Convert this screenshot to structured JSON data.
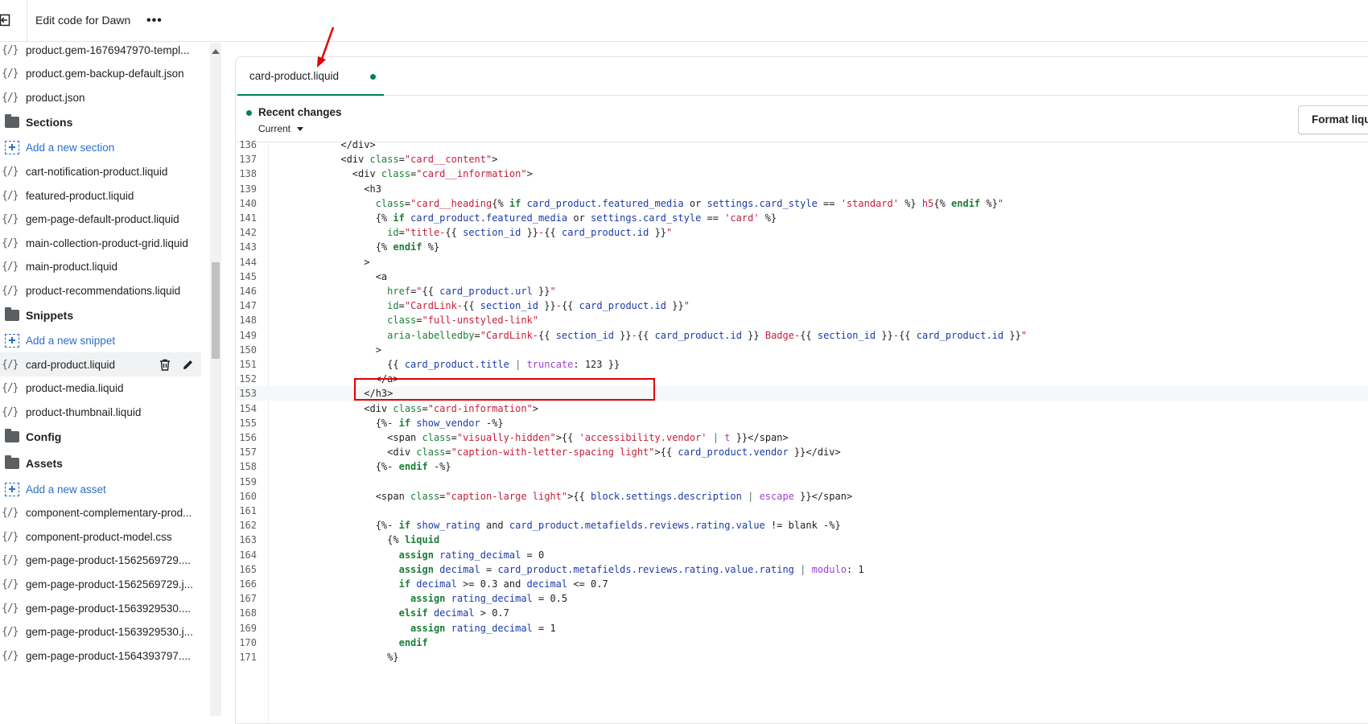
{
  "topbar": {
    "title": "Edit code for Dawn",
    "more_label": "•••"
  },
  "sidebar": {
    "items": [
      {
        "type": "file",
        "label": "product.gem-1676947970-templ..."
      },
      {
        "type": "file",
        "label": "product.gem-backup-default.json"
      },
      {
        "type": "file",
        "label": "product.json"
      },
      {
        "type": "folder",
        "label": "Sections"
      },
      {
        "type": "add",
        "label": "Add a new section"
      },
      {
        "type": "file",
        "label": "cart-notification-product.liquid"
      },
      {
        "type": "file",
        "label": "featured-product.liquid"
      },
      {
        "type": "file",
        "label": "gem-page-default-product.liquid"
      },
      {
        "type": "file",
        "label": "main-collection-product-grid.liquid"
      },
      {
        "type": "file",
        "label": "main-product.liquid"
      },
      {
        "type": "file",
        "label": "product-recommendations.liquid"
      },
      {
        "type": "folder",
        "label": "Snippets"
      },
      {
        "type": "add",
        "label": "Add a new snippet"
      },
      {
        "type": "file",
        "label": "card-product.liquid",
        "active": true
      },
      {
        "type": "file",
        "label": "product-media.liquid"
      },
      {
        "type": "file",
        "label": "product-thumbnail.liquid"
      },
      {
        "type": "folder",
        "label": "Config"
      },
      {
        "type": "folder",
        "label": "Assets"
      },
      {
        "type": "add",
        "label": "Add a new asset"
      },
      {
        "type": "file",
        "label": "component-complementary-prod..."
      },
      {
        "type": "file",
        "label": "component-product-model.css"
      },
      {
        "type": "file",
        "label": "gem-page-product-1562569729...."
      },
      {
        "type": "file",
        "label": "gem-page-product-1562569729.j..."
      },
      {
        "type": "file",
        "label": "gem-page-product-1563929530...."
      },
      {
        "type": "file",
        "label": "gem-page-product-1563929530.j..."
      },
      {
        "type": "file",
        "label": "gem-page-product-1564393797...."
      }
    ]
  },
  "editor": {
    "tab": {
      "label": "card-product.liquid",
      "unsaved": true
    },
    "changes": {
      "title": "Recent changes",
      "version": "Current"
    },
    "format_button": "Format liquid",
    "highlighted_line": 151,
    "active_line": 153,
    "lines": [
      {
        "n": "136",
        "code": [
          [
            "",
            "      </div>"
          ]
        ]
      },
      {
        "n": "137",
        "code": [
          [
            "",
            "      <div "
          ],
          [
            "attr",
            "class"
          ],
          [
            "",
            "="
          ],
          [
            "str",
            "\"card__content\""
          ],
          [
            "",
            ">"
          ]
        ]
      },
      {
        "n": "138",
        "code": [
          [
            "",
            "        <div "
          ],
          [
            "attr",
            "class"
          ],
          [
            "",
            "="
          ],
          [
            "str",
            "\"card__information\""
          ],
          [
            "",
            ">"
          ]
        ]
      },
      {
        "n": "139",
        "code": [
          [
            "",
            "          <h3"
          ]
        ]
      },
      {
        "n": "140",
        "code": [
          [
            "",
            "            "
          ],
          [
            "attr",
            "class"
          ],
          [
            "",
            "="
          ],
          [
            "str",
            "\"card__heading"
          ],
          [
            "",
            "{% "
          ],
          [
            "kw",
            "if"
          ],
          [
            "var",
            " card_product.featured_media "
          ],
          [
            "",
            "or"
          ],
          [
            "var",
            " settings.card_style "
          ],
          [
            "",
            "== "
          ],
          [
            "str",
            "'standard'"
          ],
          [
            "",
            " %} "
          ],
          [
            "str",
            "h5"
          ],
          [
            "",
            "{% "
          ],
          [
            "kw",
            "endif"
          ],
          [
            "",
            " %}"
          ],
          [
            "str",
            "\""
          ]
        ]
      },
      {
        "n": "141",
        "code": [
          [
            "",
            "            {% "
          ],
          [
            "kw",
            "if"
          ],
          [
            "var",
            " card_product.featured_media "
          ],
          [
            "",
            "or"
          ],
          [
            "var",
            " settings.card_style "
          ],
          [
            "",
            "== "
          ],
          [
            "str",
            "'card'"
          ],
          [
            "",
            " %}"
          ]
        ]
      },
      {
        "n": "142",
        "code": [
          [
            "",
            "              "
          ],
          [
            "attr",
            "id"
          ],
          [
            "",
            "="
          ],
          [
            "str",
            "\"title-"
          ],
          [
            "",
            "{{ "
          ],
          [
            "var",
            "section_id"
          ],
          [
            "",
            " }}"
          ],
          [
            "str",
            "-"
          ],
          [
            "",
            "{{ "
          ],
          [
            "var",
            "card_product.id"
          ],
          [
            "",
            " }}"
          ],
          [
            "str",
            "\""
          ]
        ]
      },
      {
        "n": "143",
        "code": [
          [
            "",
            "            {% "
          ],
          [
            "kw",
            "endif"
          ],
          [
            "",
            " %}"
          ]
        ]
      },
      {
        "n": "144",
        "code": [
          [
            "",
            "          >"
          ]
        ]
      },
      {
        "n": "145",
        "code": [
          [
            "",
            "            <a"
          ]
        ]
      },
      {
        "n": "146",
        "code": [
          [
            "",
            "              "
          ],
          [
            "attr",
            "href"
          ],
          [
            "",
            "="
          ],
          [
            "str",
            "\""
          ],
          [
            "",
            "{{ "
          ],
          [
            "var",
            "card_product.url"
          ],
          [
            "",
            " }}"
          ],
          [
            "str",
            "\""
          ]
        ]
      },
      {
        "n": "147",
        "code": [
          [
            "",
            "              "
          ],
          [
            "attr",
            "id"
          ],
          [
            "",
            "="
          ],
          [
            "str",
            "\"CardLink-"
          ],
          [
            "",
            "{{ "
          ],
          [
            "var",
            "section_id"
          ],
          [
            "",
            " }}"
          ],
          [
            "str",
            "-"
          ],
          [
            "",
            "{{ "
          ],
          [
            "var",
            "card_product.id"
          ],
          [
            "",
            " }}"
          ],
          [
            "str",
            "\""
          ]
        ]
      },
      {
        "n": "148",
        "code": [
          [
            "",
            "              "
          ],
          [
            "attr",
            "class"
          ],
          [
            "",
            "="
          ],
          [
            "str",
            "\"full-unstyled-link\""
          ]
        ]
      },
      {
        "n": "149",
        "code": [
          [
            "",
            "              "
          ],
          [
            "attr",
            "aria-labelledby"
          ],
          [
            "",
            "="
          ],
          [
            "str",
            "\"CardLink-"
          ],
          [
            "",
            "{{ "
          ],
          [
            "var",
            "section_id"
          ],
          [
            "",
            " }}"
          ],
          [
            "str",
            "-"
          ],
          [
            "",
            "{{ "
          ],
          [
            "var",
            "card_product.id"
          ],
          [
            "",
            " }} "
          ],
          [
            "str",
            "Badge-"
          ],
          [
            "",
            "{{ "
          ],
          [
            "var",
            "section_id"
          ],
          [
            "",
            " }}"
          ],
          [
            "str",
            "-"
          ],
          [
            "",
            "{{ "
          ],
          [
            "var",
            "card_product.id"
          ],
          [
            "",
            " }}"
          ],
          [
            "str",
            "\""
          ]
        ]
      },
      {
        "n": "150",
        "code": [
          [
            "",
            "            >"
          ]
        ]
      },
      {
        "n": "151",
        "code": [
          [
            "",
            "              {{ "
          ],
          [
            "var",
            "card_product.title"
          ],
          [
            "",
            " "
          ],
          [
            "pipe",
            "|"
          ],
          [
            "",
            " "
          ],
          [
            "filt",
            "truncate"
          ],
          [
            "",
            ": 123 }}"
          ]
        ]
      },
      {
        "n": "152",
        "code": [
          [
            "",
            "            </a>"
          ]
        ]
      },
      {
        "n": "153",
        "code": [
          [
            "",
            "          </h3>"
          ]
        ]
      },
      {
        "n": "154",
        "code": [
          [
            "",
            "          <div "
          ],
          [
            "attr",
            "class"
          ],
          [
            "",
            "="
          ],
          [
            "str",
            "\"card-information\""
          ],
          [
            "",
            ">"
          ]
        ]
      },
      {
        "n": "155",
        "code": [
          [
            "",
            "            {%- "
          ],
          [
            "kw",
            "if"
          ],
          [
            "var",
            " show_vendor "
          ],
          [
            "",
            "-%}"
          ]
        ]
      },
      {
        "n": "156",
        "code": [
          [
            "",
            "              <span "
          ],
          [
            "attr",
            "class"
          ],
          [
            "",
            "="
          ],
          [
            "str",
            "\"visually-hidden\""
          ],
          [
            "",
            ">{{ "
          ],
          [
            "str",
            "'accessibility.vendor'"
          ],
          [
            "",
            " "
          ],
          [
            "pipe",
            "|"
          ],
          [
            "",
            " "
          ],
          [
            "filt",
            "t"
          ],
          [
            "",
            " }}</span>"
          ]
        ]
      },
      {
        "n": "157",
        "code": [
          [
            "",
            "              <div "
          ],
          [
            "attr",
            "class"
          ],
          [
            "",
            "="
          ],
          [
            "str",
            "\"caption-with-letter-spacing light\""
          ],
          [
            "",
            ">{{ "
          ],
          [
            "var",
            "card_product.vendor"
          ],
          [
            "",
            " }}</div>"
          ]
        ]
      },
      {
        "n": "158",
        "code": [
          [
            "",
            "            {%- "
          ],
          [
            "kw",
            "endif"
          ],
          [
            "",
            " -%}"
          ]
        ]
      },
      {
        "n": "159",
        "code": [
          [
            "",
            ""
          ]
        ]
      },
      {
        "n": "160",
        "code": [
          [
            "",
            "            <span "
          ],
          [
            "attr",
            "class"
          ],
          [
            "",
            "="
          ],
          [
            "str",
            "\"caption-large light\""
          ],
          [
            "",
            ">{{ "
          ],
          [
            "var",
            "block.settings.description"
          ],
          [
            "",
            " "
          ],
          [
            "pipe",
            "|"
          ],
          [
            "",
            " "
          ],
          [
            "filt",
            "escape"
          ],
          [
            "",
            " }}</span>"
          ]
        ]
      },
      {
        "n": "161",
        "code": [
          [
            "",
            ""
          ]
        ]
      },
      {
        "n": "162",
        "code": [
          [
            "",
            "            {%- "
          ],
          [
            "kw",
            "if"
          ],
          [
            "var",
            " show_rating "
          ],
          [
            "",
            "and"
          ],
          [
            "var",
            " card_product.metafields.reviews.rating.value "
          ],
          [
            "",
            "!= blank -%}"
          ]
        ]
      },
      {
        "n": "163",
        "code": [
          [
            "",
            "              {% "
          ],
          [
            "kw",
            "liquid"
          ]
        ]
      },
      {
        "n": "164",
        "code": [
          [
            "",
            "                "
          ],
          [
            "kw",
            "assign"
          ],
          [
            "var",
            " rating_decimal "
          ],
          [
            "",
            "= 0"
          ]
        ]
      },
      {
        "n": "165",
        "code": [
          [
            "",
            "                "
          ],
          [
            "kw",
            "assign"
          ],
          [
            "var",
            " decimal "
          ],
          [
            "",
            "= "
          ],
          [
            "var",
            "card_product.metafields.reviews.rating.value.rating"
          ],
          [
            "",
            " "
          ],
          [
            "pipe",
            "|"
          ],
          [
            "",
            " "
          ],
          [
            "filt",
            "modulo"
          ],
          [
            "",
            ": 1"
          ]
        ]
      },
      {
        "n": "166",
        "code": [
          [
            "",
            "                "
          ],
          [
            "kw",
            "if"
          ],
          [
            "var",
            " decimal "
          ],
          [
            "",
            ">= 0.3 and"
          ],
          [
            "var",
            " decimal "
          ],
          [
            "",
            "<= 0.7"
          ]
        ]
      },
      {
        "n": "167",
        "code": [
          [
            "",
            "                  "
          ],
          [
            "kw",
            "assign"
          ],
          [
            "var",
            " rating_decimal "
          ],
          [
            "",
            "= 0.5"
          ]
        ]
      },
      {
        "n": "168",
        "code": [
          [
            "",
            "                "
          ],
          [
            "kw",
            "elsif"
          ],
          [
            "var",
            " decimal "
          ],
          [
            "",
            "> 0.7"
          ]
        ]
      },
      {
        "n": "169",
        "code": [
          [
            "",
            "                  "
          ],
          [
            "kw",
            "assign"
          ],
          [
            "var",
            " rating_decimal "
          ],
          [
            "",
            "= 1"
          ]
        ]
      },
      {
        "n": "170",
        "code": [
          [
            "",
            "                "
          ],
          [
            "kw",
            "endif"
          ]
        ]
      },
      {
        "n": "171",
        "code": [
          [
            "",
            "              %}"
          ]
        ]
      }
    ]
  }
}
